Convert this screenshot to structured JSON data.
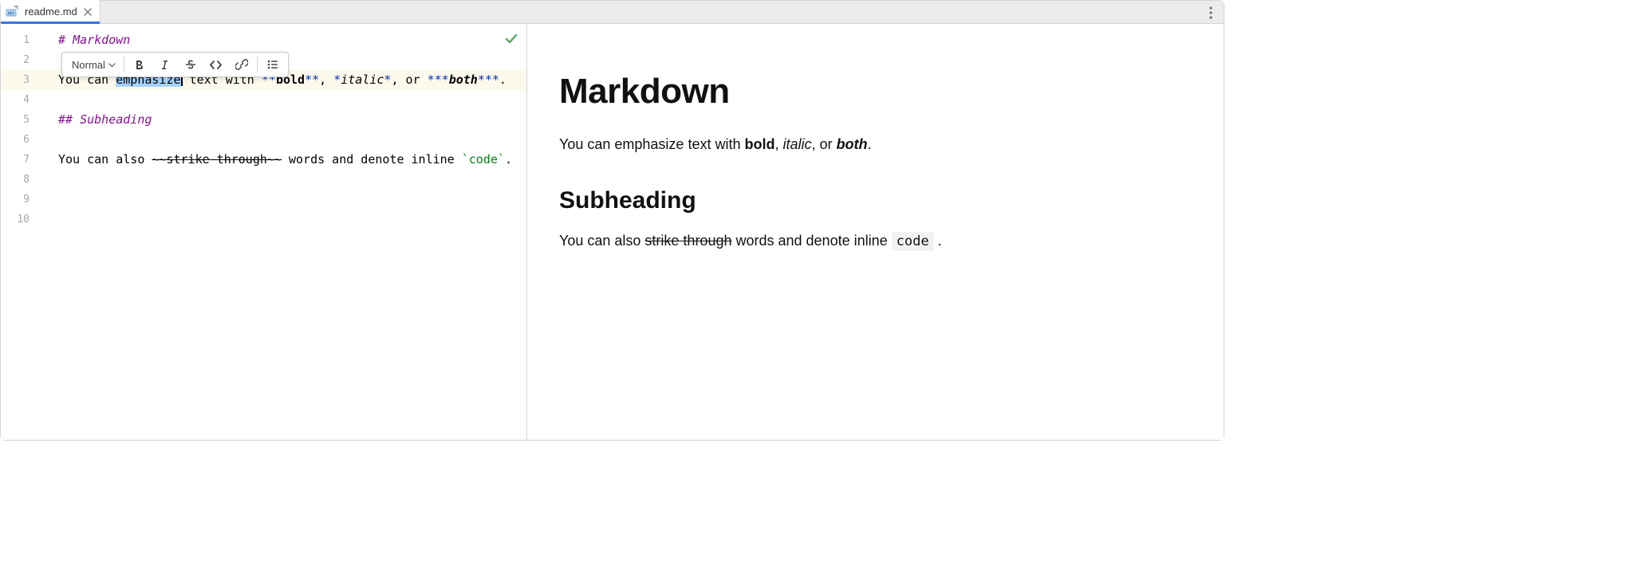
{
  "tab": {
    "filename": "readme.md",
    "icon": "markdown-file-icon"
  },
  "editor": {
    "line_numbers": [
      "1",
      "2",
      "3",
      "4",
      "5",
      "6",
      "7",
      "8",
      "9",
      "10"
    ],
    "highlighted_line_index": 2,
    "selected_text": "emphasize",
    "lines": {
      "l1_prefix": "# ",
      "l1_text": "Markdown",
      "l3_seg1": "You can ",
      "l3_sel": "emphasize",
      "l3_seg2": " text with ",
      "l3_bold_open": "**",
      "l3_bold": "bold",
      "l3_bold_close": "**",
      "l3_seg3": ", ",
      "l3_italic_open": "*",
      "l3_italic": "italic",
      "l3_italic_close": "*",
      "l3_seg4": ", or ",
      "l3_both_open": "***",
      "l3_both": "both",
      "l3_both_close": "***",
      "l3_end": ".",
      "l5_prefix": "## ",
      "l5_text": "Subheading",
      "l7_seg1": "You can also ",
      "l7_strike_open": "~~",
      "l7_strike": "strike through",
      "l7_strike_close": "~~",
      "l7_seg2": " words and denote inline ",
      "l7_code_open": "`",
      "l7_code": "code",
      "l7_code_close": "`",
      "l7_end": "."
    }
  },
  "toolbar": {
    "style_dropdown": "Normal",
    "buttons": {
      "bold": "bold",
      "italic": "italic",
      "strikethrough": "strikethrough",
      "code": "code",
      "link": "link",
      "list": "list"
    }
  },
  "status": {
    "ok": "no-problems"
  },
  "preview": {
    "h1": "Markdown",
    "p1_1": "You can emphasize text with ",
    "p1_bold": "bold",
    "p1_2": ", ",
    "p1_italic": "italic",
    "p1_3": ", or ",
    "p1_both": "both",
    "p1_4": ".",
    "h2": "Subheading",
    "p2_1": "You can also ",
    "p2_strike": "strike through",
    "p2_2": " words and denote inline ",
    "p2_code": "code",
    "p2_3": " ."
  }
}
